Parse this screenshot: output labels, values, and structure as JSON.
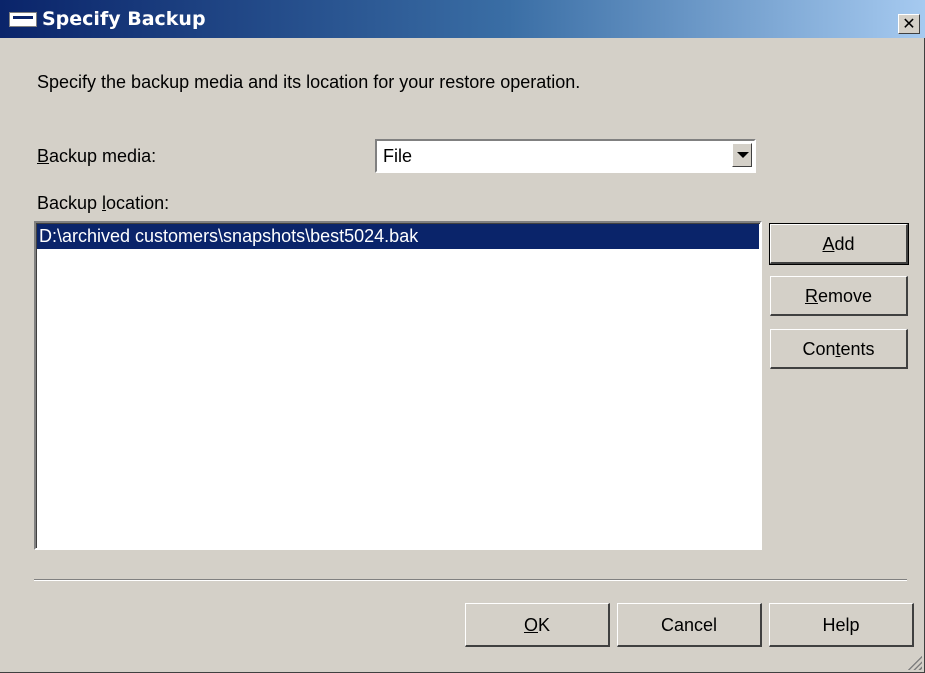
{
  "window": {
    "title": "Specify Backup",
    "close_glyph": "✕"
  },
  "instructions": "Specify the backup media and its location for your restore operation.",
  "backup_media": {
    "label_mnemonic": "B",
    "label_rest": "ackup media:",
    "selected": "File"
  },
  "backup_location": {
    "label_pre": "Backup ",
    "label_mnemonic": "l",
    "label_rest": "ocation:",
    "items": [
      "D:\\archived customers\\snapshots\\best5024.bak"
    ],
    "selected_index": 0
  },
  "side_buttons": {
    "add": {
      "mnemonic": "A",
      "rest": "dd"
    },
    "remove": {
      "mnemonic": "R",
      "rest": "emove"
    },
    "contents": {
      "pre": "Con",
      "mnemonic": "t",
      "rest": "ents"
    }
  },
  "footer_buttons": {
    "ok": {
      "mnemonic": "O",
      "rest": "K"
    },
    "cancel": "Cancel",
    "help": "Help"
  },
  "icons": {
    "window": "window-icon",
    "close": "close-icon",
    "dropdown": "chevron-down-icon",
    "grip": "resize-grip-icon"
  },
  "colors": {
    "titlebar_start": "#0a246a",
    "titlebar_end": "#a6caf0",
    "selection": "#0a246a",
    "face": "#d4d0c8"
  }
}
